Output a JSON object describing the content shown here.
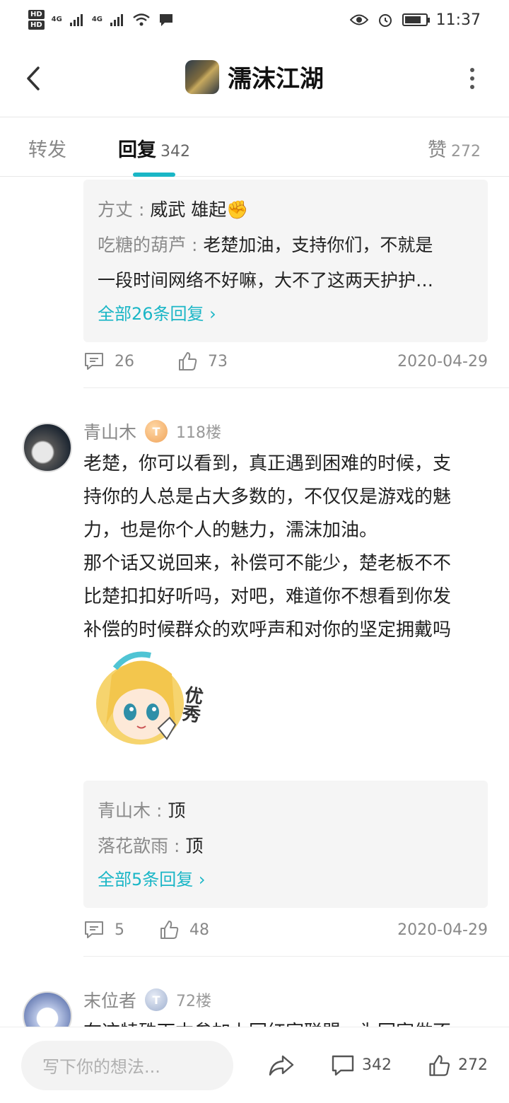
{
  "status_bar": {
    "time": "11:37",
    "hd1": "HD",
    "hd2": "HD",
    "net1": "4G",
    "net2": "4G",
    "battery_level": 0.8
  },
  "header": {
    "title": "濡沫江湖"
  },
  "tabs": {
    "forward_label": "转发",
    "reply_label": "回复",
    "reply_count": "342",
    "like_label": "赞",
    "like_count": "272"
  },
  "thread1": {
    "replies": [
      {
        "user": "方丈",
        "sep": " : ",
        "text": "威武 雄起✊"
      },
      {
        "user": "吃糖的葫芦",
        "sep": " : ",
        "text": "老楚加油，支持你们，不就是",
        "text2": "一段时间网络不好嘛，大不了这两天护护…"
      }
    ],
    "all_link": "全部26条回复 ›",
    "comments": "26",
    "likes": "73",
    "date": "2020-04-29"
  },
  "post2": {
    "user": "青山木",
    "badge": "T",
    "floor": "118楼",
    "lines": [
      "老楚，你可以看到，真正遇到困难的时候，支",
      "持你的人总是占大多数的，不仅仅是游戏的魅",
      "力，也是你个人的魅力，濡沫加油。",
      "那个话又说回来，补偿可不能少，楚老板不不",
      "比楚扣扣好听吗，对吧，难道你不想看到你发",
      "补偿的时候群众的欢呼声和对你的坚定拥戴吗"
    ],
    "sticker_text": "优秀",
    "replies": [
      {
        "user": "青山木",
        "sep": " : ",
        "text": "顶"
      },
      {
        "user": "落花歆雨",
        "sep": " : ",
        "text": "顶"
      }
    ],
    "all_link": "全部5条回复 ›",
    "comments": "5",
    "likes": "48",
    "date": "2020-04-29"
  },
  "post3": {
    "user": "末位者",
    "badge": "T",
    "floor": "72楼",
    "partial_text": "在这特殊下本参加上回红家联盟，为回家做不"
  },
  "bottom_bar": {
    "placeholder": "写下你的想法...",
    "comments": "342",
    "likes": "272"
  }
}
